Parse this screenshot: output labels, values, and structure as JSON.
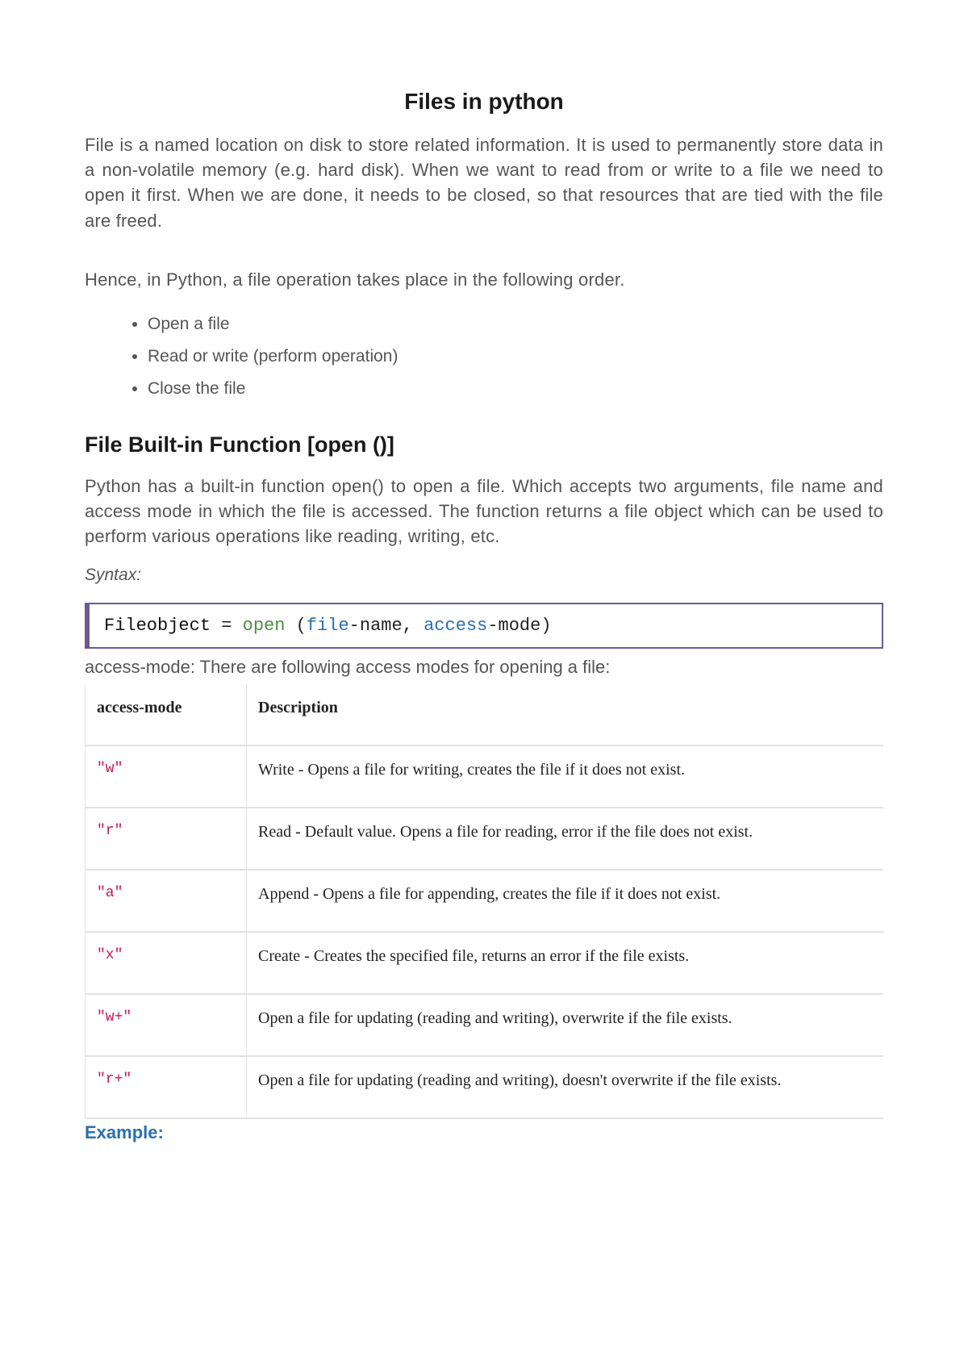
{
  "title": "Files in python",
  "para1": "File is a named location on disk to store related information. It is used to permanently store data in a non-volatile memory (e.g. hard disk). When we want to read from or write to a file we need to open it first. When we are done, it needs to be closed, so that resources that are tied with the file are freed.",
  "para2": "Hence, in Python, a file operation takes place in the following order.",
  "steps": [
    "Open a file",
    "Read or write (perform operation)",
    "Close the file"
  ],
  "h2": "File Built-in Function [open ()]",
  "para3": "Python has a built-in function open() to open a file. Which accepts two arguments, file name and access mode in which the file is accessed. The function returns a file object which can be used to perform various operations like reading, writing, etc.",
  "syntax_label": "Syntax:",
  "code": {
    "lhs": "Fileobject",
    "eq": " = ",
    "fn": "open",
    "open_paren": " (",
    "arg1a": "file",
    "arg1b": "-name, ",
    "arg2a": "access",
    "arg2b": "-mode)",
    "full": "Fileobject = open (file-name, access-mode)"
  },
  "access_intro_lead": "access-mode:",
  "access_intro_rest": " There are following access modes for opening a file:",
  "table": {
    "headers": [
      "access-mode",
      "Description"
    ],
    "rows": [
      {
        "mode": "\"w\"",
        "desc": "Write - Opens a file for writing, creates the file if it does not exist."
      },
      {
        "mode": "\"r\"",
        "desc": "Read - Default value. Opens a file for reading, error if the file does not exist."
      },
      {
        "mode": "\"a\"",
        "desc": "Append - Opens a file for appending, creates the file if it does not exist."
      },
      {
        "mode": "\"x\"",
        "desc": "Create - Creates the specified file, returns an error if the file exists."
      },
      {
        "mode": "\"w+\"",
        "desc": "Open a file for updating (reading and writing), overwrite if the file exists."
      },
      {
        "mode": "\"r+\"",
        "desc": "Open a file for updating (reading and writing), doesn't overwrite if the file exists."
      }
    ]
  },
  "example_label": "Example:"
}
